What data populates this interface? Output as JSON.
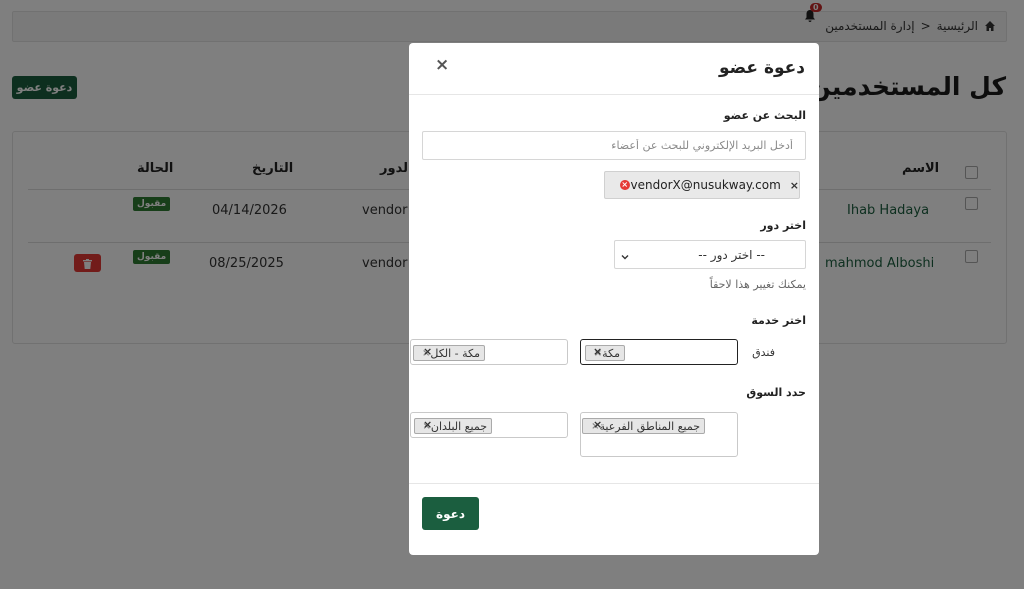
{
  "breadcrumb": {
    "home": "الرئيسية",
    "separator": "<",
    "current": "إدارة المستخدمين"
  },
  "notifications": {
    "count": "0"
  },
  "page": {
    "title": "كل المستخدمين",
    "invite_button": "دعوة عضو"
  },
  "table": {
    "columns": [
      "الاسم",
      "الدور",
      "التاريخ",
      "الحالة"
    ],
    "rows": [
      {
        "name": "Ihab Hadaya",
        "role": "vendor",
        "date": "04/14/2026",
        "status": "مقبول"
      },
      {
        "name": "mahmod Alboshi",
        "role": "vendor",
        "date": "08/25/2025",
        "status": "مقبول"
      }
    ]
  },
  "modal": {
    "title": "دعوة عضو",
    "close": "×",
    "search_label": "البحث عن عضو",
    "search_placeholder": "أدخل البريد الإلكتروني للبحث عن أعضاء",
    "email_chip": "vendorX@nusukway.com",
    "chip_remove": "×",
    "role_label": "اختر دور",
    "role_placeholder": "-- اختر دور --",
    "role_hint": "يمكنك تغيير هذا لاحقاً",
    "service_label": "اختر خدمة",
    "service_type": "فندق",
    "service_city_tag": "مكة",
    "service_scope_tag": "مكة - الكل",
    "market_label": "حدد السوق",
    "market_regions_tag": "جميع المناطق الفرعية",
    "market_countries_tag": "جميع البلدان",
    "tag_remove": "×",
    "clear": "×",
    "submit": "دعوة"
  },
  "colors": {
    "primary": "#1b5e3f",
    "success": "#2e7d32",
    "danger": "#e53935"
  }
}
